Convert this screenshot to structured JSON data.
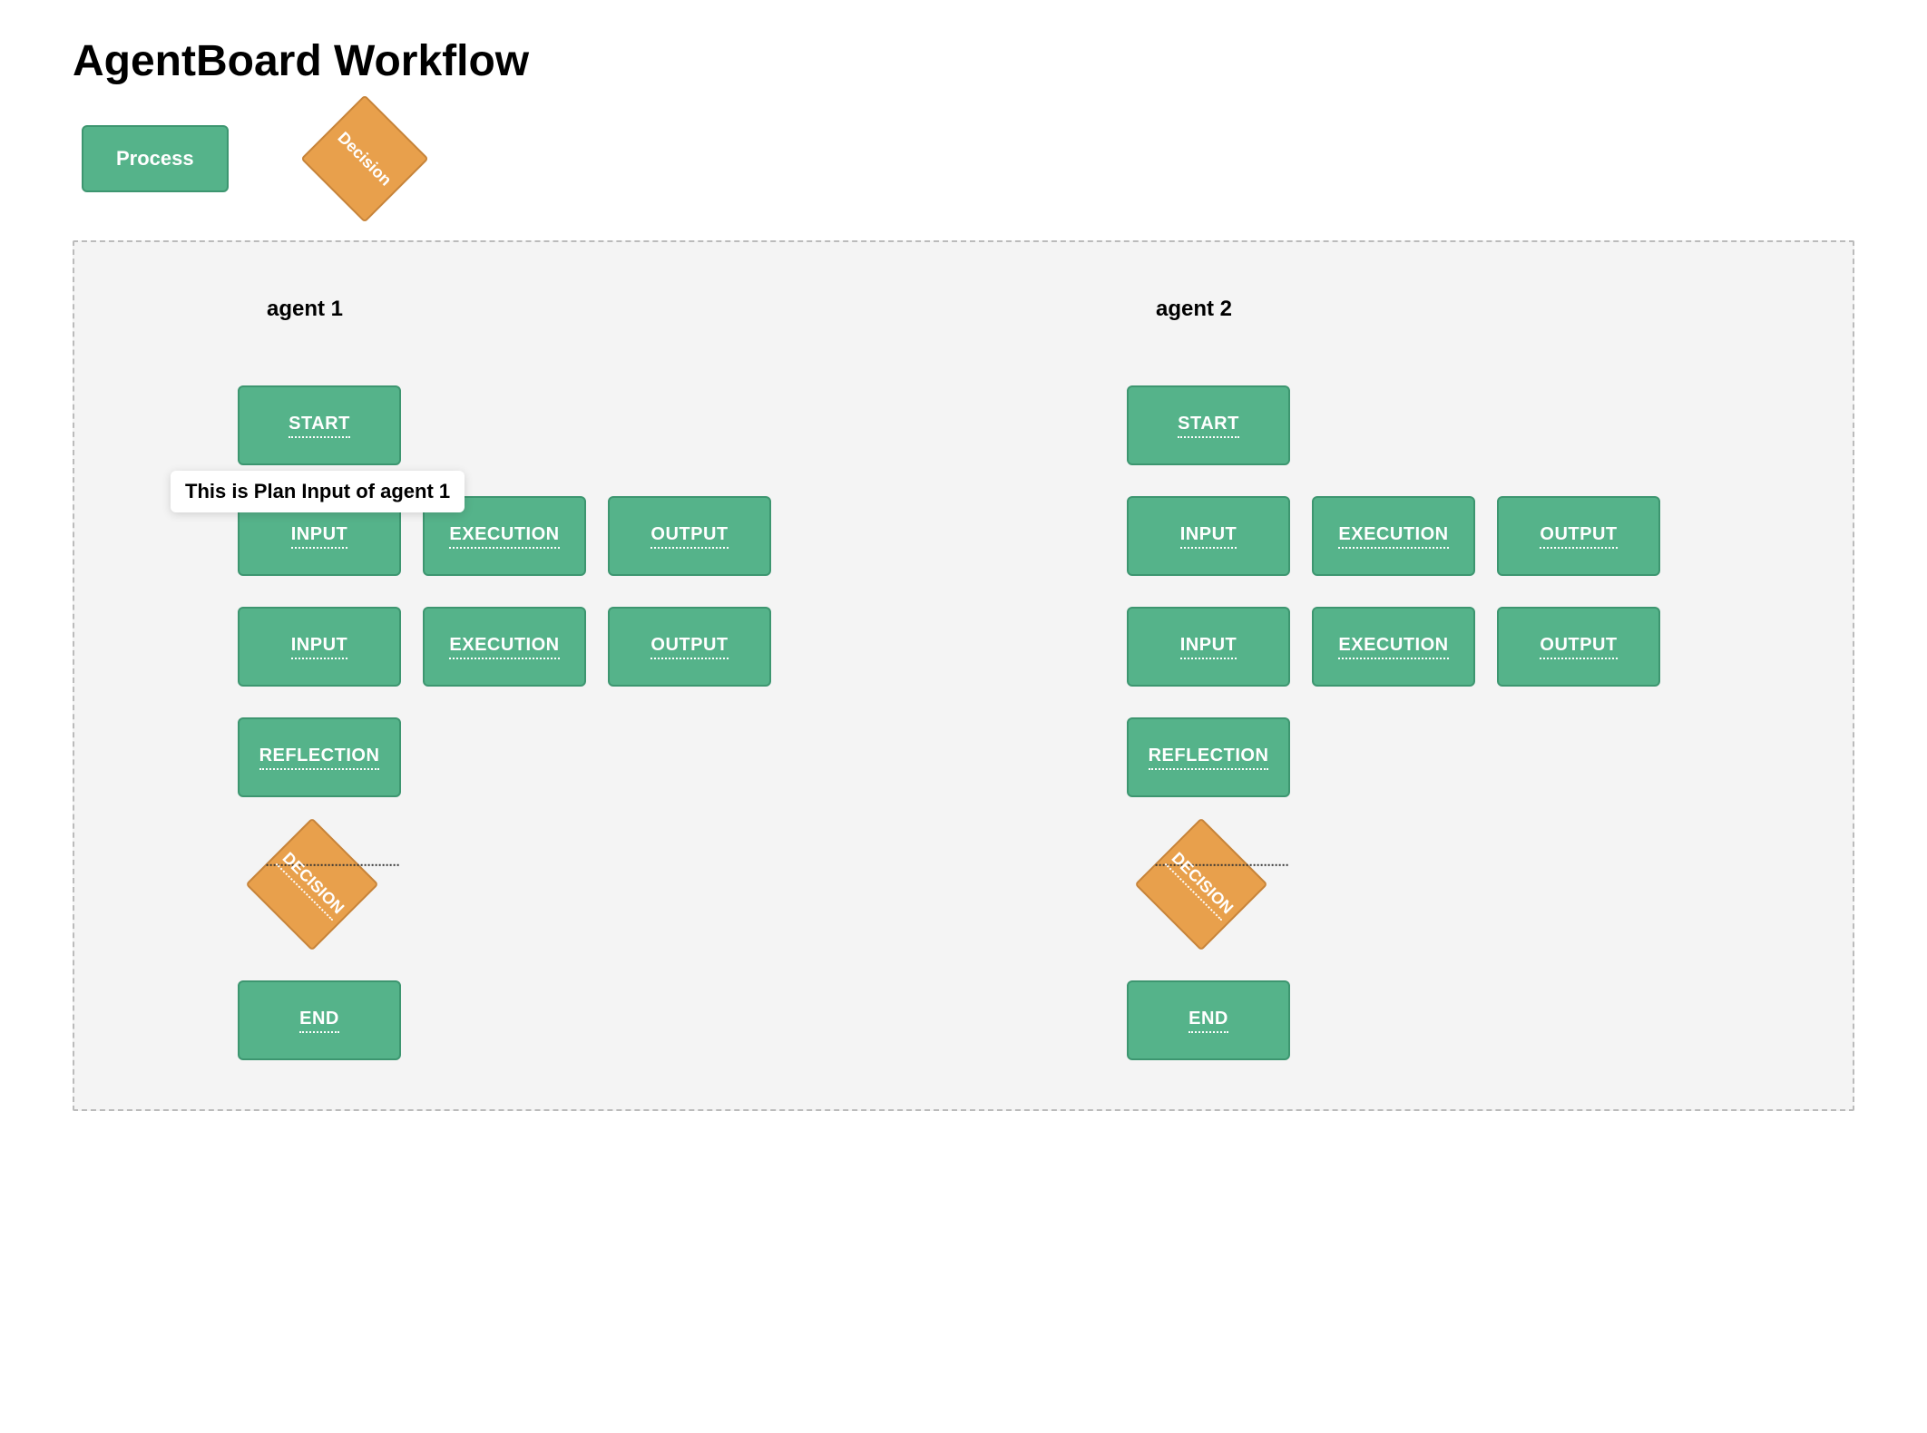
{
  "title": "AgentBoard Workflow",
  "legend": {
    "process_label": "Process",
    "decision_label": "Decision"
  },
  "tooltip": "This is Plan Input of agent 1",
  "agents": [
    {
      "title": "agent 1",
      "rows": [
        {
          "type": "process",
          "labels": [
            "START"
          ]
        },
        {
          "type": "process",
          "labels": [
            "INPUT",
            "EXECUTION",
            "OUTPUT"
          ],
          "tooltip": true
        },
        {
          "type": "process",
          "labels": [
            "INPUT",
            "EXECUTION",
            "OUTPUT"
          ]
        },
        {
          "type": "process",
          "labels": [
            "REFLECTION"
          ]
        },
        {
          "type": "decision",
          "label": "DECISION"
        },
        {
          "type": "process",
          "labels": [
            "END"
          ]
        }
      ]
    },
    {
      "title": "agent 2",
      "rows": [
        {
          "type": "process",
          "labels": [
            "START"
          ]
        },
        {
          "type": "process",
          "labels": [
            "INPUT",
            "EXECUTION",
            "OUTPUT"
          ]
        },
        {
          "type": "process",
          "labels": [
            "INPUT",
            "EXECUTION",
            "OUTPUT"
          ]
        },
        {
          "type": "process",
          "labels": [
            "REFLECTION"
          ]
        },
        {
          "type": "decision",
          "label": "DECISION"
        },
        {
          "type": "process",
          "labels": [
            "END"
          ]
        }
      ]
    }
  ],
  "colors": {
    "process_bg": "#55b38a",
    "process_border": "#3d9670",
    "decision_bg": "#e8a04c",
    "decision_border": "#c7843a",
    "container_bg": "#f4f4f4",
    "container_border": "#bbbbbb"
  }
}
